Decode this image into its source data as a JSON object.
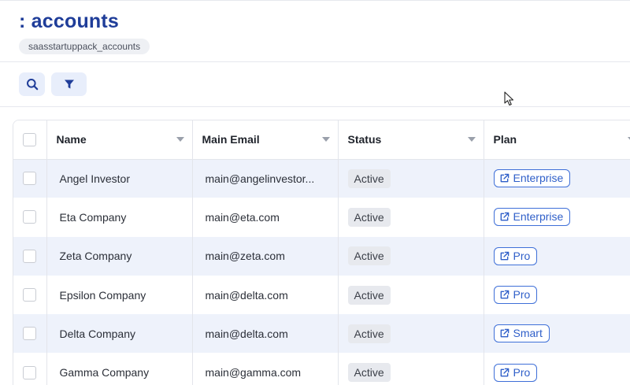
{
  "header": {
    "title": ": accounts",
    "table_name": "saasstartuppack_accounts"
  },
  "toolbar": {
    "search_icon": "search-icon",
    "filter_icon": "filter-icon"
  },
  "colors": {
    "title": "#1f3d99",
    "accent": "#2f5fc9",
    "row_stripe": "#eef2fb",
    "status_chip_bg": "#e7e9ee"
  },
  "table": {
    "columns": [
      "Name",
      "Main Email",
      "Status",
      "Plan"
    ],
    "rows": [
      {
        "name": "Angel Investor",
        "email": "main@angelinvestor...",
        "status": "Active",
        "plan": "Enterprise"
      },
      {
        "name": "Eta Company",
        "email": "main@eta.com",
        "status": "Active",
        "plan": "Enterprise"
      },
      {
        "name": "Zeta Company",
        "email": "main@zeta.com",
        "status": "Active",
        "plan": "Pro"
      },
      {
        "name": "Epsilon Company",
        "email": "main@delta.com",
        "status": "Active",
        "plan": "Pro"
      },
      {
        "name": "Delta Company",
        "email": "main@delta.com",
        "status": "Active",
        "plan": "Smart"
      },
      {
        "name": "Gamma Company",
        "email": "main@gamma.com",
        "status": "Active",
        "plan": "Pro"
      }
    ]
  }
}
